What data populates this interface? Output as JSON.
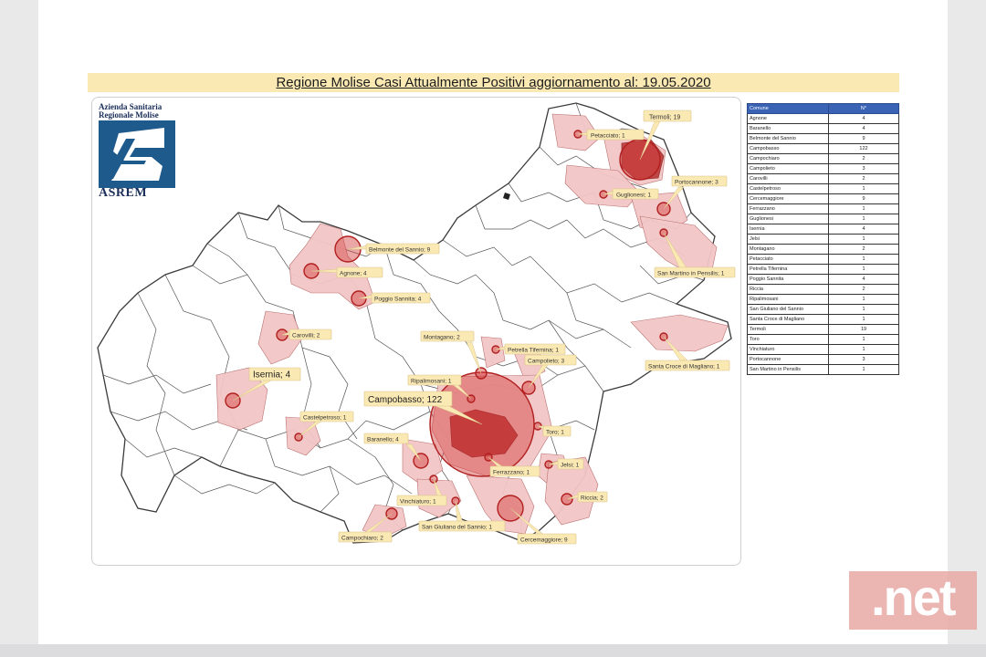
{
  "title": "Regione Molise Casi Attualmente Positivi aggiornamento al: 19.05.2020",
  "logo": {
    "line1": "Azienda Sanitaria",
    "line2": "Regionale Molise",
    "name": "ASREM"
  },
  "table": {
    "headers": [
      "Comune",
      "N°"
    ],
    "rows": [
      [
        "Agnone",
        "4"
      ],
      [
        "Baranello",
        "4"
      ],
      [
        "Belmonte del Sannio",
        "9"
      ],
      [
        "Campobasso",
        "122"
      ],
      [
        "Campochiaro",
        "2"
      ],
      [
        "Campolieto",
        "3"
      ],
      [
        "Carovilli",
        "2"
      ],
      [
        "Castelpetroso",
        "1"
      ],
      [
        "Cercemaggiore",
        "9"
      ],
      [
        "Ferrazzano",
        "1"
      ],
      [
        "Guglionesi",
        "1"
      ],
      [
        "Isernia",
        "4"
      ],
      [
        "Jelsi",
        "1"
      ],
      [
        "Montagano",
        "2"
      ],
      [
        "Petacciato",
        "1"
      ],
      [
        "Petrella Tifernina",
        "1"
      ],
      [
        "Poggio Sannita",
        "4"
      ],
      [
        "Riccia",
        "2"
      ],
      [
        "Ripalimosani",
        "1"
      ],
      [
        "San Giuliano del Sannio",
        "1"
      ],
      [
        "Santa Croce di Magliano",
        "1"
      ],
      [
        "Termoli",
        "19"
      ],
      [
        "Toro",
        "1"
      ],
      [
        "Vinchiaturo",
        "1"
      ],
      [
        "Portocannone",
        "3"
      ],
      [
        "San Martino in Pensilis",
        "1"
      ]
    ]
  },
  "map_labels": [
    "Petacciato; 1",
    "Termoli; 19",
    "Guglionesi; 1",
    "Portocannone; 3",
    "San Martino in Pensilis; 1",
    "Belmonte del Sannio; 9",
    "Agnone; 4",
    "Poggio Sannita; 4",
    "Carovilli; 2",
    "Isernia; 4",
    "Montagano; 2",
    "Petrella Tifernina; 1",
    "Campolieto; 3",
    "Santa Croce di Magliano; 1",
    "Ripalimosani; 1",
    "Campobasso; 122",
    "Castelpetroso; 1",
    "Toro; 1",
    "Baranello; 4",
    "Ferrazzano; 1",
    "Jelsi; 1",
    "Riccia; 2",
    "Vinchiaturo; 1",
    "San Giuliano del Sannio; 1",
    "Cercemaggiore; 9",
    "Campochiaro; 2"
  ],
  "watermark": ".net",
  "colors": {
    "marker": "#d23a3a",
    "highlight": "#f3c6c6",
    "table_header": "#3a62b5",
    "title_band": "#fbe9b4"
  }
}
